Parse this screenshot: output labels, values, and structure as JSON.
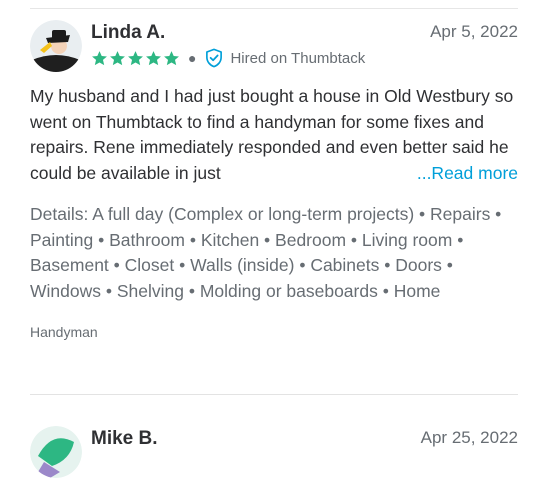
{
  "reviews": [
    {
      "name": "Linda A.",
      "date": "Apr 5, 2022",
      "rating": 5,
      "hired_badge": "Hired on Thumbtack",
      "body": "My husband and I had just bought a house in Old Westbury so went on Thumbtack to find a handyman for some fixes and repairs. Rene immediately responded and even better said he could be available in just",
      "read_more": "...Read more",
      "details": "Details: A full day (Complex or long-term projects) • Repairs • Painting • Bathroom • Kitchen • Bedroom • Living room • Basement • Closet • Walls (inside) • Cabinets • Doors • Windows • Shelving • Molding or baseboards • Home",
      "service_tag": "Handyman"
    },
    {
      "name": "Mike B.",
      "date": "Apr 25, 2022"
    }
  ],
  "colors": {
    "star": "#2db783",
    "link": "#009fd9",
    "verified": "#009fd9",
    "text": "#2f3033",
    "muted": "#676d73"
  },
  "icons": {
    "star": "star-icon",
    "verified": "shield-check-icon"
  }
}
